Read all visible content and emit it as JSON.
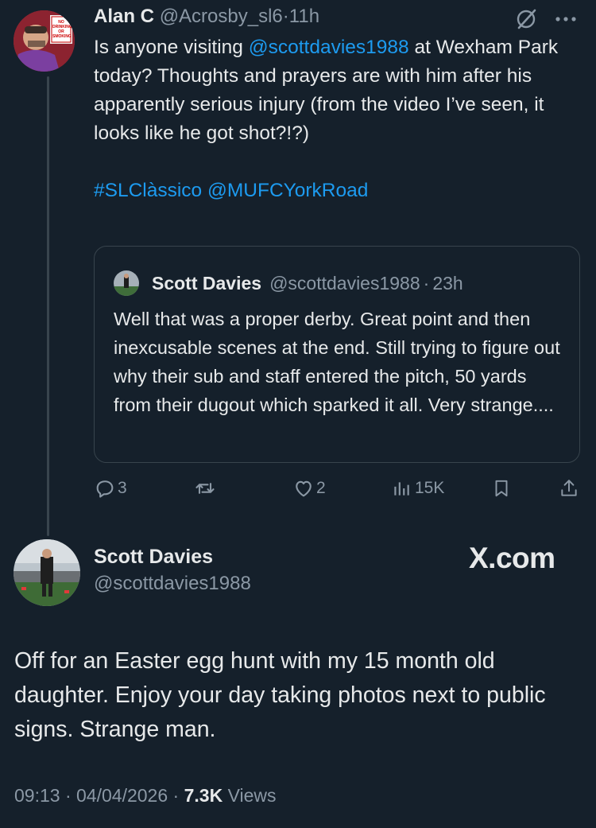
{
  "reply_tweet": {
    "author_name": "Alan C",
    "author_handle": "@Acrosby_sl6",
    "separator": "·",
    "time": "11h",
    "text_part1": "Is anyone visiting ",
    "mention": "@scottdavies1988",
    "text_part2": " at Wexham Park today? Thoughts and prayers are with him after his apparently serious injury (from the video I’ve seen, it looks like he got shot?!?)",
    "hashtag": "#SLClàssico",
    "mention2": "@MUFCYorkRoad",
    "avatar_sign_text": "NO DRINKING OR SMOKING"
  },
  "quoted_tweet": {
    "author_name": "Scott Davies",
    "author_handle": "@scottdavies1988",
    "separator": "·",
    "time": "23h",
    "text": "Well that was a proper derby. Great point and then inexcusable scenes at the end. Still trying to figure out why their sub and staff entered the pitch, 50 yards from their dugout which sparked it all. Very strange...."
  },
  "actions": {
    "replies": "3",
    "likes": "2",
    "views": "15K"
  },
  "main_tweet": {
    "author_name": "Scott Davies",
    "author_handle": "@scottdavies1988",
    "brand": "X.com",
    "text": "Off for an Easter egg hunt with my 15 month old daughter. Enjoy your day taking photos next to public signs. Strange man.",
    "time": "09:13",
    "date": "04/04/2026",
    "separator": "·",
    "views_count": "7.3K",
    "views_label": "Views"
  },
  "icons": [
    "grok-icon",
    "more-icon",
    "reply-icon",
    "retweet-icon",
    "like-icon",
    "views-icon",
    "bookmark-icon",
    "share-icon"
  ],
  "colors": {
    "background": "#15202b",
    "text": "#e7e9ea",
    "muted": "#8b98a5",
    "link": "#1d9bf0",
    "border": "#38444d"
  }
}
